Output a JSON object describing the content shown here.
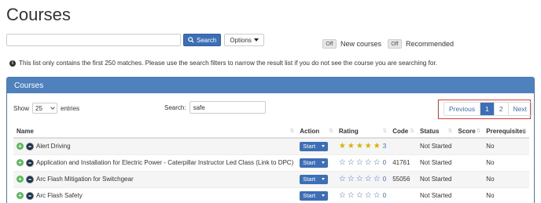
{
  "page": {
    "title": "Courses"
  },
  "search": {
    "placeholder": "",
    "button_label": "Search",
    "options_label": "Options"
  },
  "toggles": [
    {
      "state": "Off",
      "label": "New courses"
    },
    {
      "state": "Off",
      "label": "Recommended"
    }
  ],
  "notice": "This list only contains the first 250 matches. Please use the search filters to narrow the result list if you do not see the course you are searching for.",
  "panel": {
    "title": "Courses",
    "show_label": "Show",
    "length_value": "25",
    "entries_label": "entries",
    "filter_label": "Search:",
    "filter_value": "safe"
  },
  "pagination": {
    "previous": "Previous",
    "pages": [
      "1",
      "2"
    ],
    "active_page": "1",
    "next": "Next"
  },
  "table": {
    "columns": [
      "Name",
      "Action",
      "Rating",
      "Code",
      "Status",
      "Score",
      "Prerequisites"
    ],
    "rows": [
      {
        "name": "Alert Driving",
        "action": "Start",
        "rating": 4.5,
        "rating_count": "3",
        "code": "",
        "status": "Not Started",
        "score": "",
        "prerequisites": "No"
      },
      {
        "name": "Application and Installation for Electric Power - Caterpillar Instructor Led Class (Link to DPC)",
        "action": "Start",
        "rating": 0,
        "rating_count": "0",
        "code": "41761",
        "status": "Not Started",
        "score": "",
        "prerequisites": "No"
      },
      {
        "name": "Arc Flash Mitigation for Switchgear",
        "action": "Start",
        "rating": 0,
        "rating_count": "0",
        "code": "55056",
        "status": "Not Started",
        "score": "",
        "prerequisites": "No"
      },
      {
        "name": "Arc Flash Safety",
        "action": "Start",
        "rating": 0,
        "rating_count": "0",
        "code": "",
        "status": "Not Started",
        "score": "",
        "prerequisites": "No"
      }
    ]
  },
  "icons": {
    "search_icon": "search-icon",
    "info_icon": "info-icon",
    "expand_icon": "plus-circle-icon",
    "course_icon": "course-icon",
    "star_full": "star-full-icon",
    "star_empty": "star-empty-icon"
  },
  "colors": {
    "primary": "#3c6fb5",
    "panel_header": "#4f81bd",
    "star": "#d9b100",
    "highlight": "#d93b3b",
    "expand": "#5cb85c"
  }
}
